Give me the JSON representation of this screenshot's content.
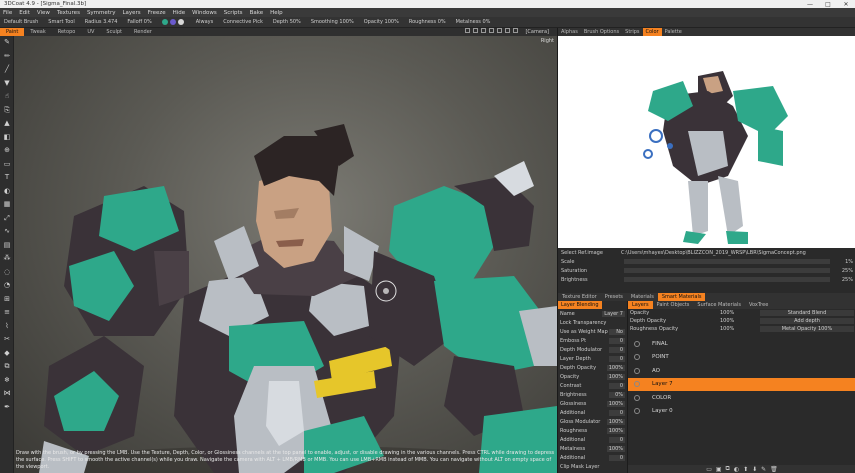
{
  "window": {
    "title": "3DCoat 4.9 - [Sigma_Final.3b]",
    "buttons": [
      "—",
      "□",
      "✕"
    ]
  },
  "menu": [
    "File",
    "Edit",
    "View",
    "Textures",
    "Symmetry",
    "Layers",
    "Freeze",
    "Hide",
    "Windows",
    "Scripts",
    "Bake",
    "Help"
  ],
  "tool_options": {
    "preset": "Default Brush",
    "smart_tool": "Smart Tool",
    "radius": "Radius 3.474",
    "falloff": "Falloff 0%",
    "depth": "Depth 50%",
    "smoothing": "Smoothing 100%",
    "opacity": "Opacity 100%",
    "roughness": "Roughness 0%",
    "metalness": "Metalness 0%",
    "mode": "Always",
    "connective": "Connective Pick"
  },
  "rooms": [
    {
      "label": "Paint",
      "active": true
    },
    {
      "label": "Tweak",
      "active": false
    },
    {
      "label": "Retopo",
      "active": false
    },
    {
      "label": "UV",
      "active": false
    },
    {
      "label": "Sculpt",
      "active": false
    },
    {
      "label": "Render",
      "active": false
    }
  ],
  "camera": "[Camera]",
  "viewport": {
    "view_name": "Right",
    "hint": "Draw with the brush, or by pressing the LMB. Use the Texture, Depth, Color, or Glossiness channels at the top panel to enable, adjust, or disable drawing in the various channels. Press CTRL while drawing to depress the surface. Press SHIFT to smooth the active channel(s) while you draw. Navigate the camera with ALT + LMB/RMB or MMB. You can use LMB+RMB instead of MMB. You can navigate without ALT on empty space of the viewport."
  },
  "tools": [
    "brush",
    "pencil",
    "line",
    "fill",
    "smudge",
    "clone",
    "stamp",
    "eraser",
    "picker",
    "select",
    "text",
    "mask",
    "pattern",
    "transform",
    "snake",
    "gradient",
    "spray",
    "blur",
    "fade",
    "ruler",
    "layer",
    "stroke",
    "cut",
    "sharpen",
    "copy",
    "freeze",
    "butterfly",
    "pen"
  ],
  "right_tabs": [
    {
      "label": "Alphas",
      "active": false
    },
    {
      "label": "Brush Options",
      "active": false
    },
    {
      "label": "Strips",
      "active": false
    },
    {
      "label": "Color",
      "active": true
    },
    {
      "label": "Palette",
      "active": false
    }
  ],
  "reference": {
    "panel": "Select Ref.image",
    "path": "C:\\Users\\mhayes\\Desktop\\BLIZZCON_2019_WRSP\\LBR\\SigmaConcept.png",
    "rows": [
      {
        "label": "Scale",
        "value": "1%"
      },
      {
        "label": "Saturation",
        "value": "25%"
      },
      {
        "label": "Brightness",
        "value": "25%"
      }
    ]
  },
  "panel_tabs": [
    {
      "label": "Texture Editor",
      "active": false
    },
    {
      "label": "Presets",
      "active": false
    },
    {
      "label": "Materials",
      "active": false
    },
    {
      "label": "Smart Materials",
      "active": true
    }
  ],
  "blending": {
    "tabs": [
      {
        "label": "Layer Blending",
        "active": true
      }
    ],
    "rows": [
      {
        "label": "Name",
        "value": "Layer 7"
      },
      {
        "label": "Lock Transparency",
        "value": ""
      },
      {
        "label": "Use as Weight Map",
        "value": "No"
      },
      {
        "label": "Emboss Pt",
        "value": "0"
      },
      {
        "label": "Depth Modulator",
        "value": "0"
      },
      {
        "label": "Layer Depth",
        "value": "0"
      },
      {
        "label": "Depth Opacity",
        "value": "100%"
      },
      {
        "label": "Opacity",
        "value": "100%"
      },
      {
        "label": "Contrast",
        "value": "0"
      },
      {
        "label": "Brightness",
        "value": "0%"
      },
      {
        "label": "Glossiness",
        "value": "100%"
      },
      {
        "label": "Additional",
        "value": "0"
      },
      {
        "label": "Gloss Modulator",
        "value": "100%"
      },
      {
        "label": "Roughness",
        "value": "100%"
      },
      {
        "label": "Additional",
        "value": "0"
      },
      {
        "label": "Metalness",
        "value": "100%"
      },
      {
        "label": "Additional",
        "value": "0"
      },
      {
        "label": "Clip Mask Layer",
        "value": ""
      },
      {
        "label": "Pool Clip Mask",
        "value": ""
      },
      {
        "label": "Invert Clip Mask",
        "value": ""
      }
    ]
  },
  "layers_panel": {
    "tabs": [
      {
        "label": "Layers",
        "active": true
      },
      {
        "label": "Paint Objects",
        "active": false
      },
      {
        "label": "Surface Materials",
        "active": false
      },
      {
        "label": "VoxTree",
        "active": false
      }
    ],
    "props": [
      {
        "label": "Opacity",
        "value": "100%",
        "option": "Standard Blend"
      },
      {
        "label": "Depth Opacity",
        "value": "100%",
        "option": "Add depth"
      },
      {
        "label": "Roughness Opacity",
        "value": "100%",
        "option": "Metal Opacity 100%"
      }
    ],
    "layers": [
      {
        "name": "FINAL",
        "active": false
      },
      {
        "name": "POINT",
        "active": false
      },
      {
        "name": "AO",
        "active": false
      },
      {
        "name": "Layer 7",
        "active": true
      },
      {
        "name": "COLOR",
        "active": false
      },
      {
        "name": "Layer 0",
        "active": false
      }
    ],
    "footer": [
      "▭",
      "▣",
      "⧉",
      "◐",
      "⬆",
      "⬇",
      "✎",
      "🗑"
    ]
  },
  "colors": {
    "accent": "#f58220",
    "armor_teal": "#2ea88a",
    "armor_dark": "#3a3238",
    "armor_grey": "#b9bec4",
    "accent_yellow": "#e6c62a"
  }
}
